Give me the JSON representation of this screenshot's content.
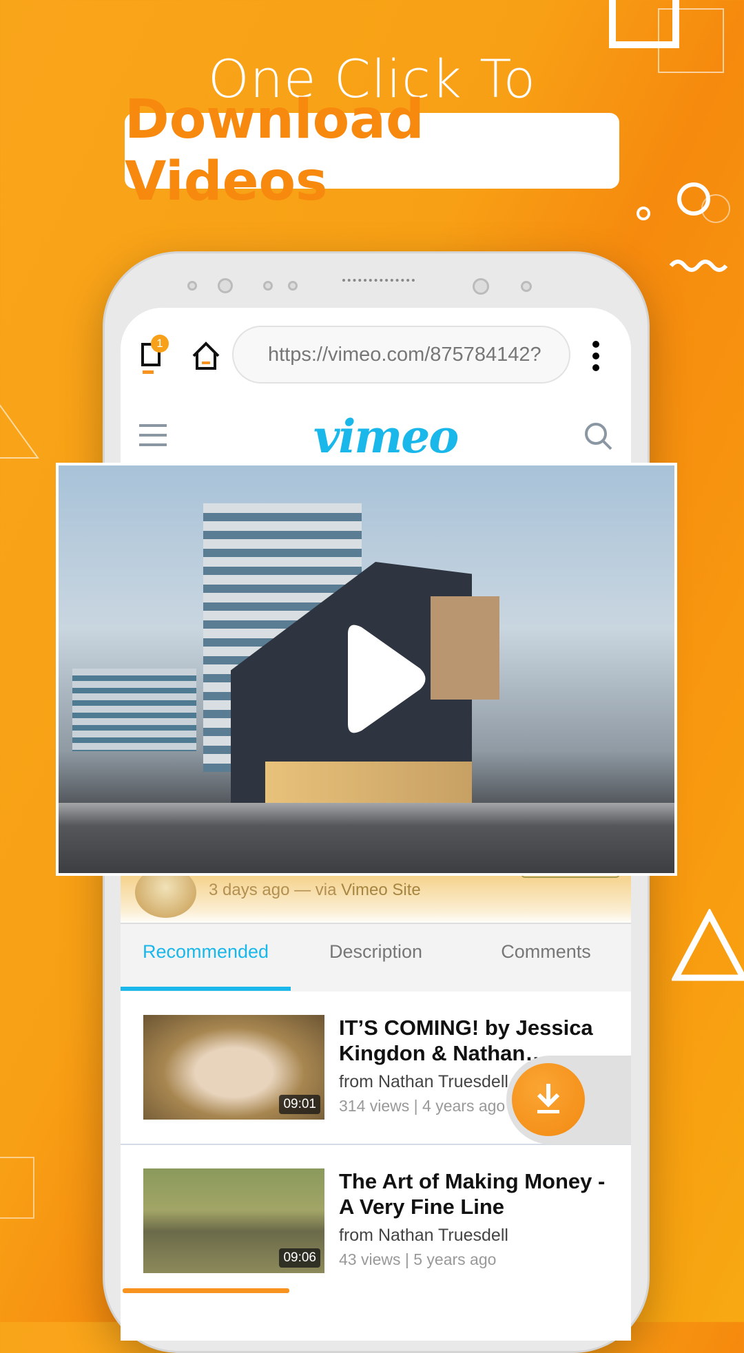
{
  "promo": {
    "line1": "One Click To",
    "line2": "Download Videos"
  },
  "browser": {
    "tab_count": "1",
    "url": "https://vimeo.com/875784142?"
  },
  "site": {
    "logo": "vimeo"
  },
  "video_meta": {
    "posted": "3 days ago — via ",
    "source": "Vimeo Site"
  },
  "tabs": [
    {
      "label": "Recommended",
      "active": true
    },
    {
      "label": "Description"
    },
    {
      "label": "Comments"
    }
  ],
  "videos": [
    {
      "title": "IT’S COMING! by Jessica Kingdon & Nathan…",
      "author": "from Nathan Truesdell",
      "stats": "314 views | 4 years ago",
      "duration": "09:01"
    },
    {
      "title": "The Art of Making Money - A Very Fine Line",
      "author": "from Nathan Truesdell",
      "stats": "43 views | 5 years ago",
      "duration": "09:06"
    }
  ],
  "colors": {
    "accent": "#f7890f",
    "vimeo": "#1ab7ea",
    "fab": "#f7931e"
  }
}
